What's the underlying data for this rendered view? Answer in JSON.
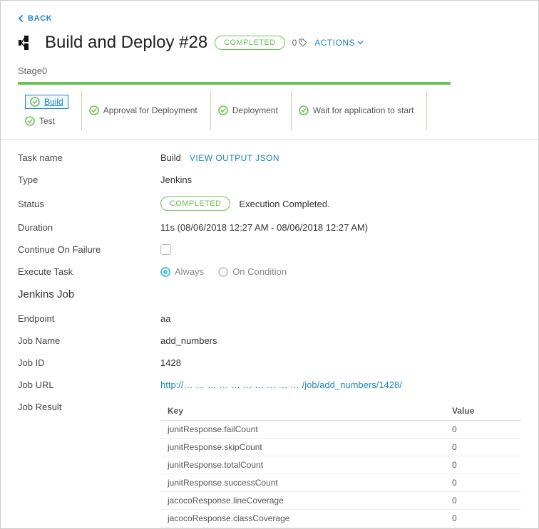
{
  "nav": {
    "back": "BACK"
  },
  "header": {
    "title": "Build and Deploy #28",
    "status": "COMPLETED",
    "tag_count": "0",
    "actions_label": "ACTIONS"
  },
  "stage": {
    "name": "Stage0",
    "columns": [
      {
        "tasks": [
          {
            "label": "Build",
            "selected": true,
            "link": true
          },
          {
            "label": "Test"
          }
        ]
      },
      {
        "tasks": [
          {
            "label": "Approval for Deployment"
          }
        ]
      },
      {
        "tasks": [
          {
            "label": "Deployment"
          }
        ]
      },
      {
        "tasks": [
          {
            "label": "Wait for application to start"
          }
        ]
      }
    ]
  },
  "details": {
    "labels": {
      "task_name": "Task name",
      "type": "Type",
      "status": "Status",
      "duration": "Duration",
      "continue_on_failure": "Continue On Failure",
      "execute_task": "Execute Task"
    },
    "task_name": "Build",
    "view_json": "VIEW OUTPUT JSON",
    "type": "Jenkins",
    "status_badge": "COMPLETED",
    "status_text": "Execution Completed.",
    "duration": "11s (08/06/2018 12:27 AM - 08/06/2018 12:27 AM)",
    "execute_always": "Always",
    "execute_on_condition": "On Condition"
  },
  "jenkins": {
    "heading": "Jenkins Job",
    "labels": {
      "endpoint": "Endpoint",
      "job_name": "Job Name",
      "job_id": "Job ID",
      "job_url": "Job URL",
      "job_result": "Job Result"
    },
    "endpoint": "aa",
    "job_name": "add_numbers",
    "job_id": "1428",
    "job_url": "http://… … … … … … … … … … /job/add_numbers/1428/",
    "result_headers": {
      "key": "Key",
      "value": "Value"
    },
    "results": [
      {
        "key": "junitResponse.failCount",
        "value": "0"
      },
      {
        "key": "junitResponse.skipCount",
        "value": "0"
      },
      {
        "key": "junitResponse.totalCount",
        "value": "0"
      },
      {
        "key": "junitResponse.successCount",
        "value": "0"
      },
      {
        "key": "jacocoResponse.lineCoverage",
        "value": "0"
      },
      {
        "key": "jacocoResponse.classCoverage",
        "value": "0"
      }
    ]
  }
}
